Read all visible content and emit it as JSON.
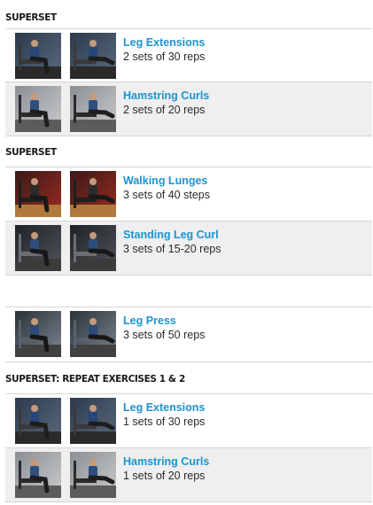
{
  "sections": [
    {
      "title": "SUPERSET",
      "exercises": [
        {
          "name": "Leg Extensions",
          "sets": "2 sets of 30 reps",
          "scene": "gym-blue"
        },
        {
          "name": "Hamstring Curls",
          "sets": "2 sets of 20 reps",
          "scene": "gym-bright"
        }
      ]
    },
    {
      "title": "SUPERSET",
      "exercises": [
        {
          "name": "Walking Lunges",
          "sets": "3 sets of 40 steps",
          "scene": "gym-red"
        },
        {
          "name": "Standing Leg Curl",
          "sets": "3 sets of 15-20 reps",
          "scene": "gym-dark"
        }
      ]
    },
    {
      "title": "",
      "exercises": [
        {
          "name": "Leg Press",
          "sets": "3 sets of 50 reps",
          "scene": "gym-press"
        }
      ]
    },
    {
      "title": "SUPERSET: REPEAT EXERCISES 1 & 2",
      "exercises": [
        {
          "name": "Leg Extensions",
          "sets": "1 sets of 30 reps",
          "scene": "gym-blue"
        },
        {
          "name": "Hamstring Curls",
          "sets": "1 sets of 20 reps",
          "scene": "gym-bright"
        }
      ]
    }
  ],
  "colors": {
    "link": "#1c93d0",
    "shaded_row": "#efefef",
    "divider": "#d5d5d5"
  }
}
